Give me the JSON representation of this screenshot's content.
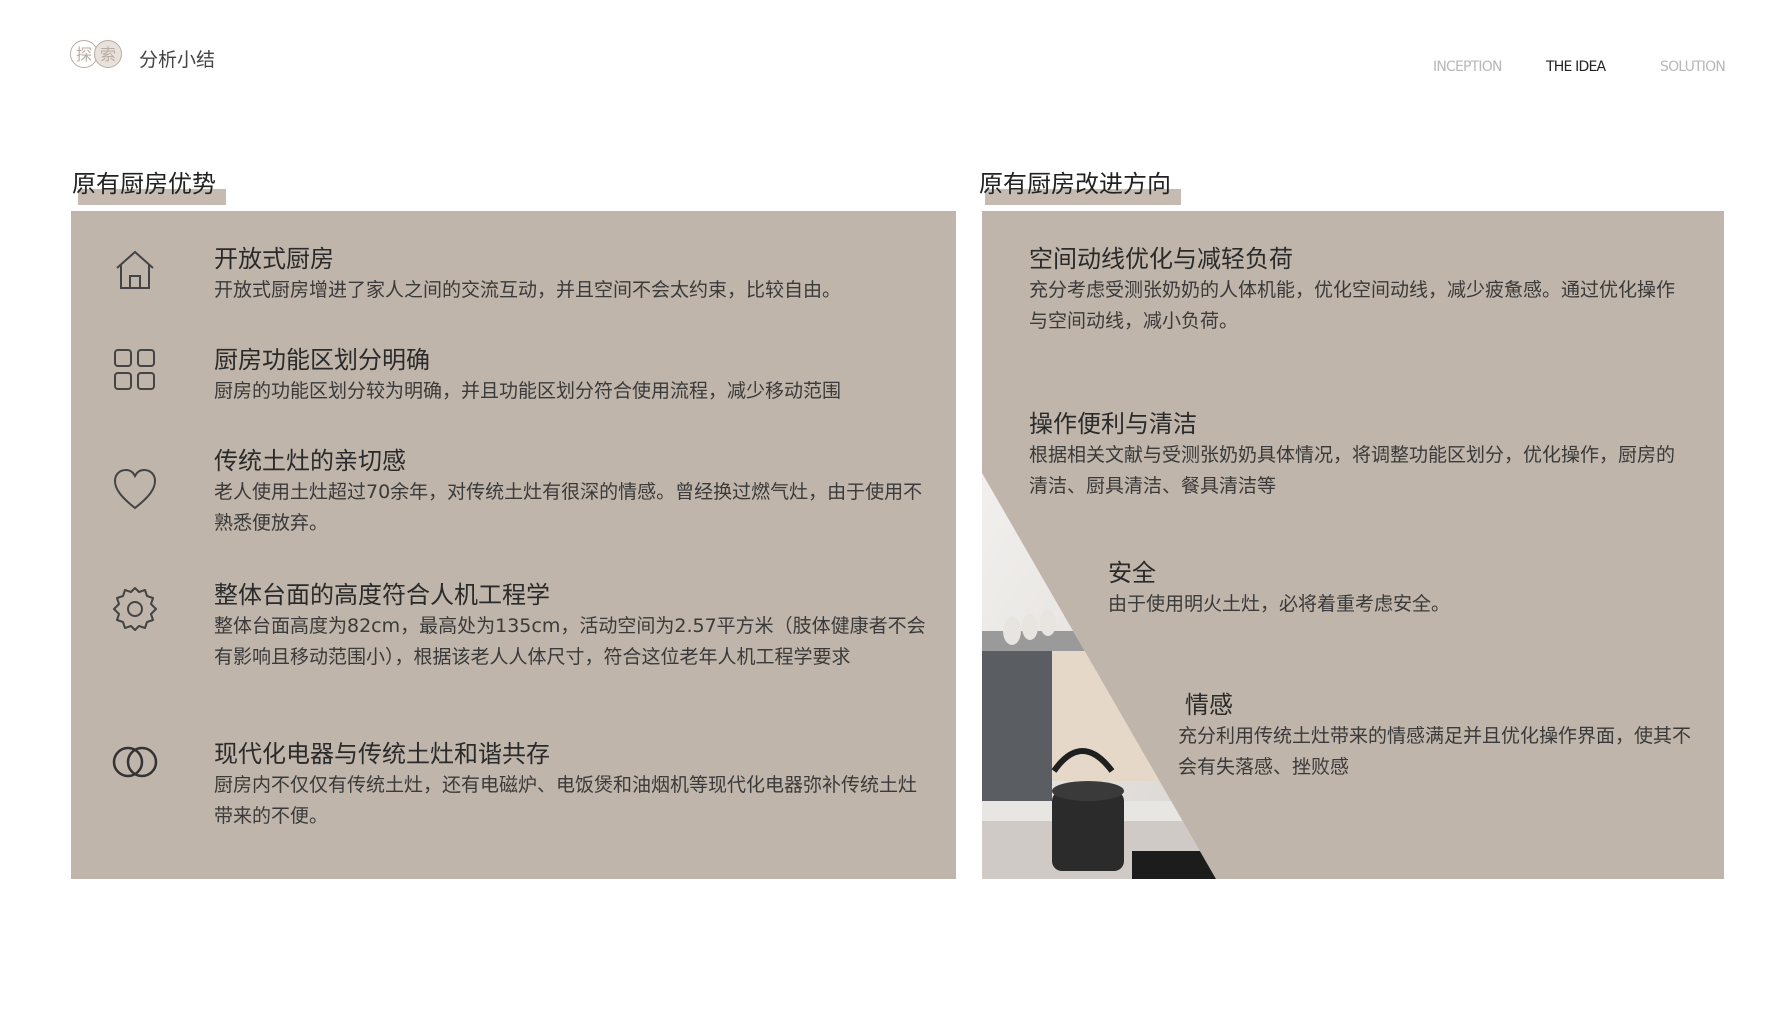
{
  "header": {
    "logo_chars": [
      "探",
      "索"
    ],
    "brand_label": "分析小结",
    "nav": [
      {
        "label": "INCEPTION",
        "active": false
      },
      {
        "label": "THE IDEA",
        "active": true
      },
      {
        "label": "SOLUTION",
        "active": false
      }
    ]
  },
  "left": {
    "heading": "原有厨房优势",
    "items": [
      {
        "icon": "house-icon",
        "title": "开放式厨房",
        "desc": "开放式厨房增进了家人之间的交流互动，并且空间不会太约束，比较自由。"
      },
      {
        "icon": "grid-icon",
        "title": "厨房功能区划分明确",
        "desc": "厨房的功能区划分较为明确，并且功能区划分符合使用流程，减少移动范围"
      },
      {
        "icon": "heart-icon",
        "title": "传统土灶的亲切感",
        "desc": "老人使用土灶超过70余年，对传统土灶有很深的情感。曾经换过燃气灶，由于使用不熟悉便放弃。"
      },
      {
        "icon": "gear-icon",
        "title": "整体台面的高度符合人机工程学",
        "desc": "整体台面高度为82cm，最高处为135cm，活动空间为2.57平方米（肢体健康者不会有影响且移动范围小），根据该老人人体尺寸，符合这位老年人机工程学要求"
      },
      {
        "icon": "rings-icon",
        "title": "现代化电器与传统土灶和谐共存",
        "desc": "厨房内不仅仅有传统土灶，还有电磁炉、电饭煲和油烟机等现代化电器弥补传统土灶带来的不便。"
      }
    ]
  },
  "right": {
    "heading": "原有厨房改进方向",
    "items": [
      {
        "title": "空间动线优化与减轻负荷",
        "desc": "充分考虑受测张奶奶的人体机能，优化空间动线，减少疲惫感。通过优化操作与空间动线，减小负荷。"
      },
      {
        "title": "操作便利与清洁",
        "desc": "根据相关文献与受测张奶奶具体情况，将调整功能区划分，优化操作，厨房的清洁、厨具清洁、餐具清洁等"
      },
      {
        "title": "安全",
        "desc": "由于使用明火土灶，必将着重考虑安全。"
      },
      {
        "title": "情感",
        "desc": "充分利用传统土灶带来的情感满足并且优化操作界面，使其不会有失落感、挫败感"
      }
    ]
  },
  "colors": {
    "panel": "#c0b5ab",
    "accent": "#c7bab0"
  }
}
